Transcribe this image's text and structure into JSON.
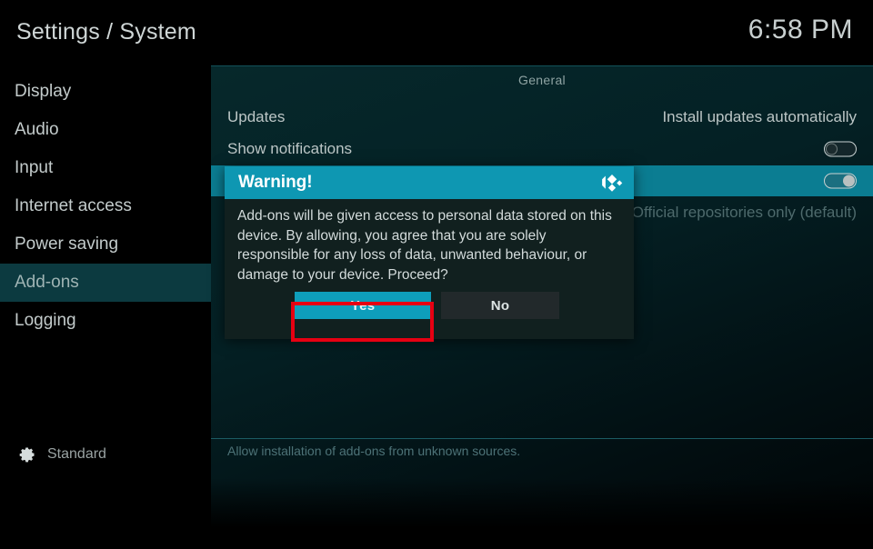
{
  "header": {
    "title": "Settings / System",
    "clock": "6:58 PM"
  },
  "sidebar": {
    "items": [
      {
        "label": "Display",
        "selected": false
      },
      {
        "label": "Audio",
        "selected": false
      },
      {
        "label": "Input",
        "selected": false
      },
      {
        "label": "Internet access",
        "selected": false
      },
      {
        "label": "Power saving",
        "selected": false
      },
      {
        "label": "Add-ons",
        "selected": true
      },
      {
        "label": "Logging",
        "selected": false
      }
    ],
    "profile": {
      "icon": "gear-icon",
      "label": "Standard"
    }
  },
  "main": {
    "section_header": "General",
    "rows": [
      {
        "name": "Updates",
        "value": "Install updates automatically",
        "control": "text",
        "highlighted": false,
        "dim": false
      },
      {
        "name": "Show notifications",
        "value": "",
        "control": "toggle-off",
        "highlighted": false,
        "dim": false
      },
      {
        "name": "",
        "value": "",
        "control": "toggle-on",
        "highlighted": true,
        "dim": false
      },
      {
        "name": "",
        "value": "Official repositories only (default)",
        "control": "text",
        "highlighted": false,
        "dim": true
      }
    ],
    "help_text": "Allow installation of add-ons from unknown sources."
  },
  "dialog": {
    "title": "Warning!",
    "logo_icon": "kodi-logo-icon",
    "message": "Add-ons will be given access to personal data stored on this device. By allowing, you agree that you are solely responsible for any loss of data, unwanted behaviour, or damage to your device. Proceed?",
    "buttons": [
      {
        "label": "Yes",
        "focused": true
      },
      {
        "label": "No",
        "focused": false
      }
    ]
  },
  "colors": {
    "accent": "#0e97b2",
    "dialog_bg": "#11201f",
    "sidebar_selected": "#0c3a40",
    "row_highlight": "#0b7d92",
    "focus_outline": "#e60012",
    "yes_button": "#0e9ebb",
    "no_button": "#22292b"
  }
}
